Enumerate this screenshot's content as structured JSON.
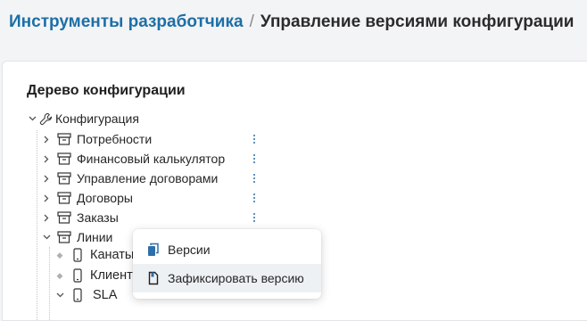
{
  "breadcrumb": {
    "parent": "Инструменты разработчика",
    "separator": "/",
    "current": "Управление версиями конфигурации"
  },
  "panel": {
    "title": "Дерево конфигурации"
  },
  "tree": {
    "root": {
      "label": "Конфигурация",
      "icon": "wrench-icon",
      "expanded": true
    },
    "items": [
      {
        "label": "Потребности",
        "icon": "archive-box-icon",
        "expanded": false
      },
      {
        "label": "Финансовый калькулятор",
        "icon": "archive-box-icon",
        "expanded": false
      },
      {
        "label": "Управление договорами",
        "icon": "archive-box-icon",
        "expanded": false
      },
      {
        "label": "Договоры",
        "icon": "archive-box-icon",
        "expanded": false
      },
      {
        "label": "Заказы",
        "icon": "archive-box-icon",
        "expanded": false
      },
      {
        "label": "Линии",
        "icon": "archive-box-icon",
        "expanded": true
      }
    ],
    "children": [
      {
        "label": "Канаты",
        "icon": "mobile-device-icon"
      },
      {
        "label": "Клиенты",
        "icon": "mobile-device-icon"
      },
      {
        "label": "SLA",
        "icon": "mobile-device-icon",
        "expanded": true
      }
    ]
  },
  "context_menu": {
    "items": [
      {
        "label": "Версии",
        "icon": "copy-pages-icon"
      },
      {
        "label": "Зафиксировать версию",
        "icon": "pinned-document-icon",
        "hovered": true
      }
    ]
  },
  "colors": {
    "link": "#1d6fa5",
    "accent": "#2e6fa8",
    "background": "#f3f4f6",
    "panel": "#ffffff"
  }
}
